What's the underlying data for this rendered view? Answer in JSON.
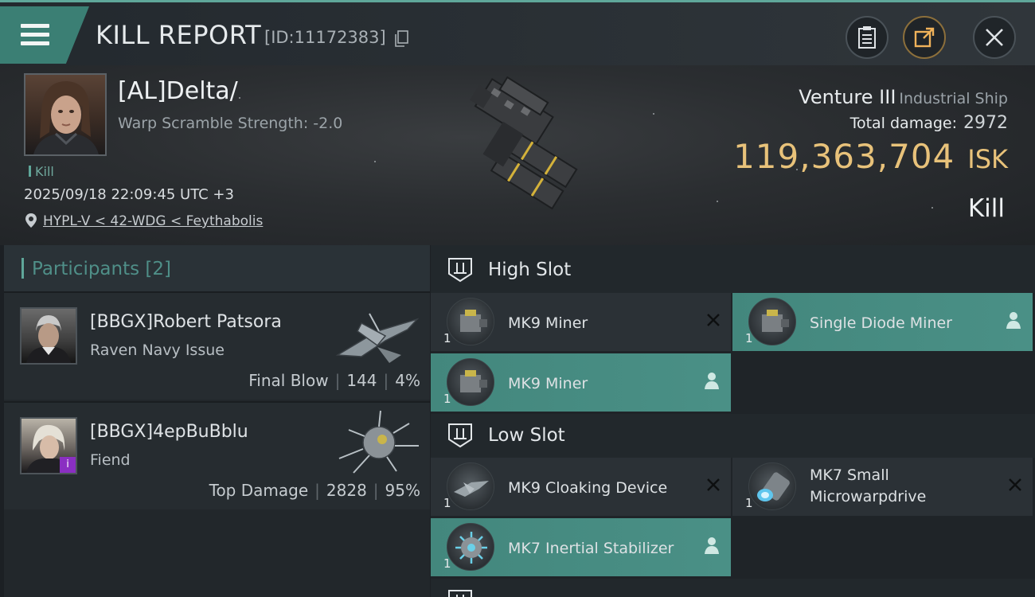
{
  "header": {
    "title": "KILL REPORT",
    "report_id": "[ID:11172383]"
  },
  "victim": {
    "name": "[AL]Delta/",
    "warp_scramble": "Warp Scramble Strength: -2.0",
    "tag": "Kill",
    "datetime": "2025/09/18 22:09:45 UTC +3",
    "location": "HYPL-V < 42-WDG < Feythabolis",
    "ship_name": "Venture III",
    "ship_class": "Industrial Ship",
    "total_damage_label": "Total damage:",
    "total_damage": "2972",
    "isk_value": "119,363,704",
    "isk_unit": "ISK",
    "result": "Kill"
  },
  "participants": {
    "label": "Participants",
    "count": "[2]",
    "rows": [
      {
        "name": "[BBGX]Robert Patsora",
        "ship": "Raven Navy Issue",
        "role": "Final Blow",
        "damage": "144",
        "percent": "4%"
      },
      {
        "name": "[BBGX]4epBuBblu",
        "ship": "Fiend",
        "role": "Top Damage",
        "damage": "2828",
        "percent": "95%",
        "badge": "i"
      }
    ]
  },
  "fitting": {
    "high_slot": {
      "title": "High Slot",
      "modules": [
        {
          "name": "MK9 Miner",
          "qty": "1",
          "state": "destroyed",
          "icon": "miner-icon"
        },
        {
          "name": "Single Diode Miner",
          "qty": "1",
          "state": "dropped",
          "icon": "miner-icon"
        },
        {
          "name": "MK9 Miner",
          "qty": "1",
          "state": "dropped",
          "icon": "miner-icon"
        }
      ]
    },
    "low_slot": {
      "title": "Low Slot",
      "modules": [
        {
          "name": "MK9 Cloaking Device",
          "qty": "1",
          "state": "destroyed",
          "icon": "cloak-icon"
        },
        {
          "name_line1": "MK7 Small",
          "name_line2": "Microwarpdrive",
          "qty": "1",
          "state": "destroyed",
          "icon": "mwd-icon"
        },
        {
          "name": "MK7 Inertial Stabilizer",
          "qty": "1",
          "state": "dropped",
          "icon": "stabilizer-icon"
        }
      ]
    }
  },
  "colors": {
    "accent": "#5fa79a",
    "isk": "#e8c27a",
    "module_active": "#4a9086"
  }
}
